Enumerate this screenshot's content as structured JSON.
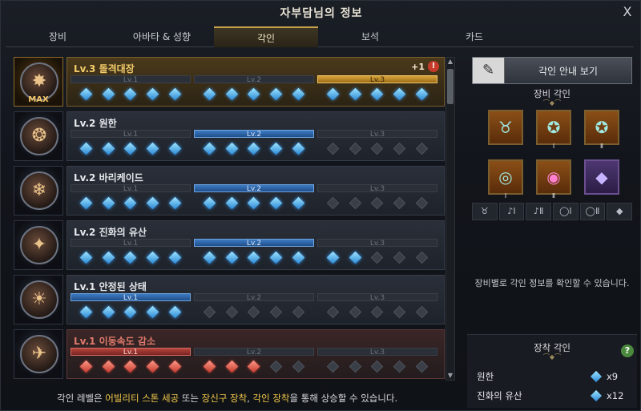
{
  "window": {
    "title": "자부담님의 정보",
    "close_label": "X"
  },
  "tabs": [
    {
      "label": "장비",
      "active": false
    },
    {
      "label": "아바타 & 성향",
      "active": false
    },
    {
      "label": "각인",
      "active": true
    },
    {
      "label": "보석",
      "active": false
    },
    {
      "label": "카드",
      "active": false
    }
  ],
  "engravings": [
    {
      "title": "Lv.3 돌격대장",
      "style": "gold",
      "badge": "MAX",
      "extra_plus": "+1",
      "extra_warn": "!",
      "level_labels": [
        "Lv.1",
        "Lv.2",
        "Lv.3"
      ],
      "active_level": 3,
      "gem_color": "blue",
      "gems_filled": 15
    },
    {
      "title": "Lv.2 원한",
      "style": "normal",
      "badge": "",
      "level_labels": [
        "Lv.1",
        "Lv.2",
        "Lv.3"
      ],
      "active_level": 2,
      "gem_color": "blue",
      "gems_filled": 10
    },
    {
      "title": "Lv.2 바리케이드",
      "style": "normal",
      "badge": "",
      "level_labels": [
        "Lv.1",
        "Lv.2",
        "Lv.3"
      ],
      "active_level": 2,
      "gem_color": "blue",
      "gems_filled": 10
    },
    {
      "title": "Lv.2 진화의 유산",
      "style": "normal",
      "badge": "",
      "level_labels": [
        "Lv.1",
        "Lv.2",
        "Lv.3"
      ],
      "active_level": 2,
      "gem_color": "blue",
      "gems_filled": 12
    },
    {
      "title": "Lv.1 안정된 상태",
      "style": "normal",
      "badge": "",
      "level_labels": [
        "Lv.1",
        "Lv.2",
        "Lv.3"
      ],
      "active_level": 1,
      "gem_color": "blue",
      "gems_filled": 5
    },
    {
      "title": "Lv.1 이동속도 감소",
      "style": "red",
      "badge": "",
      "level_labels": [
        "Lv.1",
        "Lv.2",
        "Lv.3"
      ],
      "active_level": 1,
      "gem_color": "red",
      "gems_filled": 8
    }
  ],
  "hint": {
    "prefix": "각인 레벨은 ",
    "hl1": "어빌리티 스톤 세공",
    "mid1": " 또는 ",
    "hl2": "장신구 장착",
    "mid2": ", ",
    "hl3": "각인 장착",
    "suffix": "을 통해 상승할 수 있습니다."
  },
  "right_panel": {
    "guide_button": "각인 안내 보기",
    "equip_section_title": "장비 각인",
    "equip_slots": [
      {
        "icon": "necklace-icon",
        "num": ""
      },
      {
        "icon": "earring-icon",
        "num": "Ⅰ"
      },
      {
        "icon": "earring-icon",
        "num": "Ⅱ"
      },
      {
        "icon": "ring-icon",
        "num": "Ⅰ"
      },
      {
        "icon": "ring-icon",
        "num": "Ⅱ"
      },
      {
        "icon": "ability-stone-icon",
        "num": ""
      }
    ],
    "filters": [
      "♉",
      "♪Ⅰ",
      "♪Ⅱ",
      "◯Ⅰ",
      "◯Ⅱ",
      "◆"
    ],
    "empty_message": "장비별로 각인 정보를 확인할 수 있습니다.",
    "equipped_title": "장착 각인",
    "help_label": "?",
    "equipped_items": [
      {
        "name": "원한",
        "count": "x9"
      },
      {
        "name": "진화의 유산",
        "count": "x12"
      }
    ]
  },
  "colors": {
    "gold_accent": "#c6a14d",
    "active_level_blue": "#3d7bc2",
    "highlight_yellow": "#f2c84b",
    "negative_red": "#b5433b"
  }
}
